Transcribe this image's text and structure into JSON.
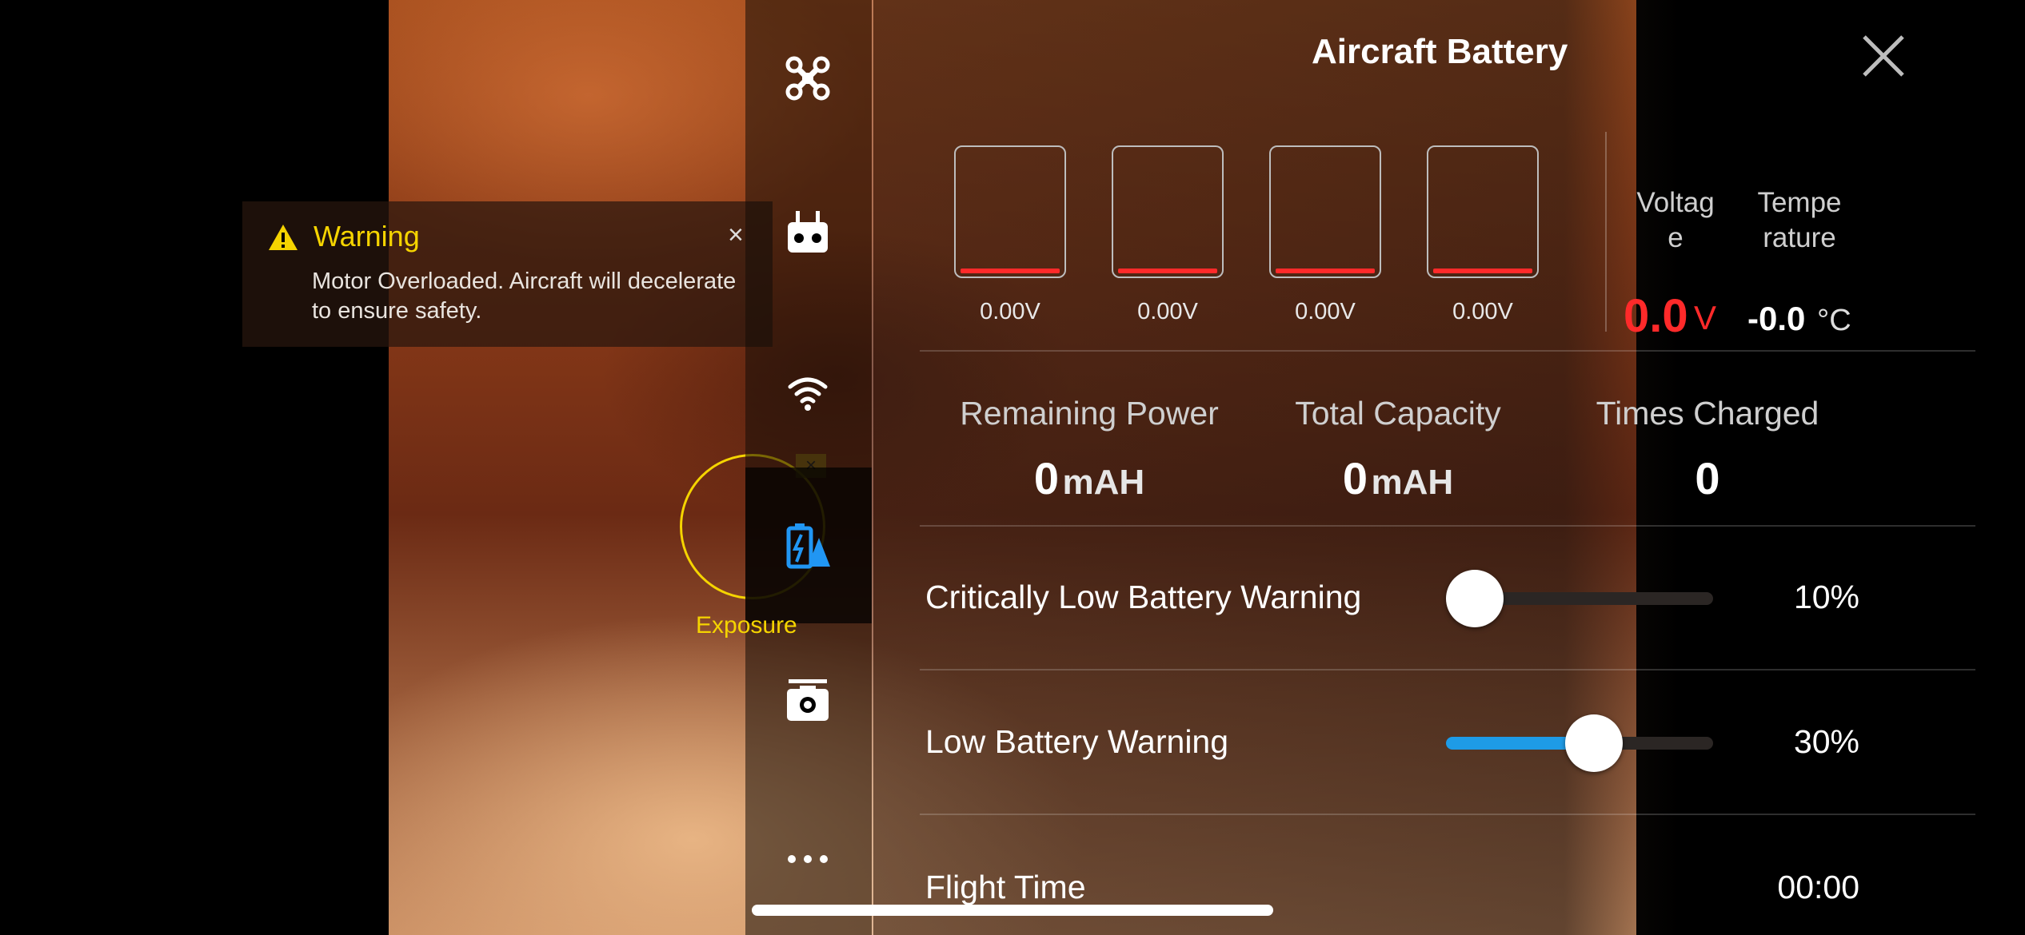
{
  "warning": {
    "title": "Warning",
    "message": "Motor Overloaded. Aircraft will decelerate to ensure safety.",
    "close_glyph": "×",
    "icon": "warning-triangle-icon"
  },
  "exposure": {
    "label": "Exposure",
    "tag": "×"
  },
  "sidebar": {
    "items": [
      {
        "icon": "aircraft-icon"
      },
      {
        "icon": "remote-controller-icon"
      },
      {
        "icon": "wifi-signal-icon"
      },
      {
        "icon": "battery-settings-icon",
        "selected": true
      },
      {
        "icon": "camera-icon"
      },
      {
        "icon": "more-icon"
      }
    ]
  },
  "panel": {
    "title": "Aircraft Battery",
    "close_icon": "close-icon",
    "cells": [
      {
        "voltage": "0.00V",
        "level": 0.0
      },
      {
        "voltage": "0.00V",
        "level": 0.0
      },
      {
        "voltage": "0.00V",
        "level": 0.0
      },
      {
        "voltage": "0.00V",
        "level": 0.0
      }
    ],
    "voltage": {
      "label_line1": "Voltag",
      "label_line2": "e",
      "value": "0.0",
      "unit": "V"
    },
    "temperature": {
      "label_line1": "Tempe",
      "label_line2": "rature",
      "value": "-0.0",
      "unit": "°C"
    },
    "stats": {
      "remaining_power": {
        "label": "Remaining Power",
        "value": "0",
        "unit": "mAH"
      },
      "total_capacity": {
        "label": "Total Capacity",
        "value": "0",
        "unit": "mAH"
      },
      "times_charged": {
        "label": "Times Charged",
        "value": "0"
      }
    },
    "critical_warning": {
      "label": "Critically Low Battery Warning",
      "value": "10%",
      "level": 0.1
    },
    "low_warning": {
      "label": "Low Battery Warning",
      "value": "30%",
      "level": 0.3
    },
    "flight_time": {
      "label": "Flight Time",
      "value": "00:00"
    }
  },
  "colors": {
    "accent_blue": "#1e9be6",
    "alert_red": "#ff2a2a",
    "warning_yellow": "#f5d400"
  }
}
